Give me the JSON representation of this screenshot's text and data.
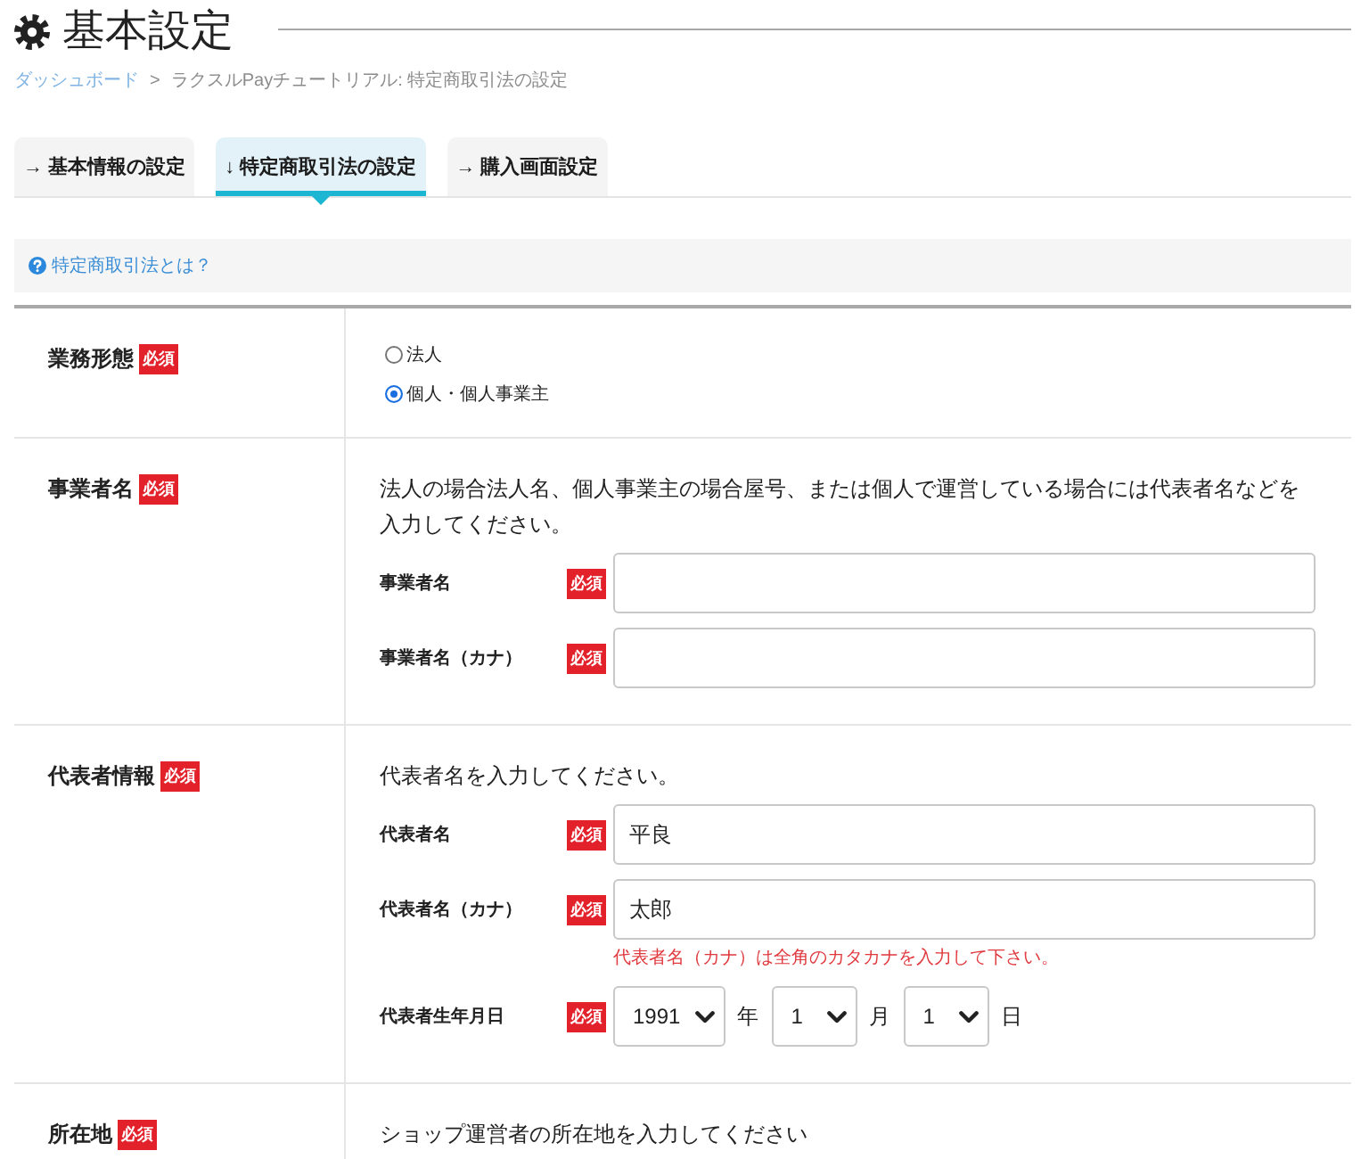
{
  "page": {
    "title": "基本設定"
  },
  "breadcrumb": {
    "separator": ">",
    "items": [
      {
        "label": "ダッシュボード",
        "kind": "link"
      },
      {
        "label": "ラクスルPayチュートリアル: 特定商取引法の設定",
        "kind": "current"
      }
    ]
  },
  "tabs": [
    {
      "label": "→ 基本情報の設定",
      "selected": false
    },
    {
      "label": "↓ 特定商取引法の設定",
      "selected": true
    },
    {
      "label": "→ 購入画面設定",
      "selected": false
    }
  ],
  "help_link": {
    "label": "特定商取引法とは？"
  },
  "form": {
    "rows": [
      {
        "kind": "choice",
        "label": "業務形態",
        "badge": "必須",
        "options": [
          {
            "label": "法人",
            "selected": false
          },
          {
            "label": "個人・個人事業主",
            "selected": true
          }
        ]
      },
      {
        "kind": "entry",
        "label": "事業者名",
        "badge": "必須",
        "description": "法人の場合法人名、個人事業主の場合屋号、または個人で運営している場合には代表者名などを入力してください。",
        "fields": [
          {
            "kind": "text",
            "label": "事業者名",
            "badge": "必須"
          },
          {
            "kind": "text",
            "label": "事業者名（カナ）",
            "badge": "必須"
          }
        ]
      },
      {
        "kind": "entry",
        "label": "代表者情報",
        "badge": "必須",
        "description": "代表者名を入力してください。",
        "fields": [
          {
            "kind": "text",
            "label": "代表者名",
            "badge": "必須",
            "value": "平良"
          },
          {
            "kind": "text",
            "label": "代表者名（カナ）",
            "badge": "必須",
            "value": "太郎",
            "error": "代表者名（カナ）は全角のカタカナを入力して下さい。"
          },
          {
            "kind": "date",
            "label": "代表者生年月日",
            "badge": "必須",
            "parts": [
              {
                "value": "1991",
                "unit": "年"
              },
              {
                "value": "1",
                "unit": "月"
              },
              {
                "value": "1",
                "unit": "日"
              }
            ]
          }
        ]
      },
      {
        "kind": "entry",
        "label": "所在地",
        "badge": "必須",
        "description": "ショップ運営者の所在地を入力してください"
      }
    ]
  }
}
